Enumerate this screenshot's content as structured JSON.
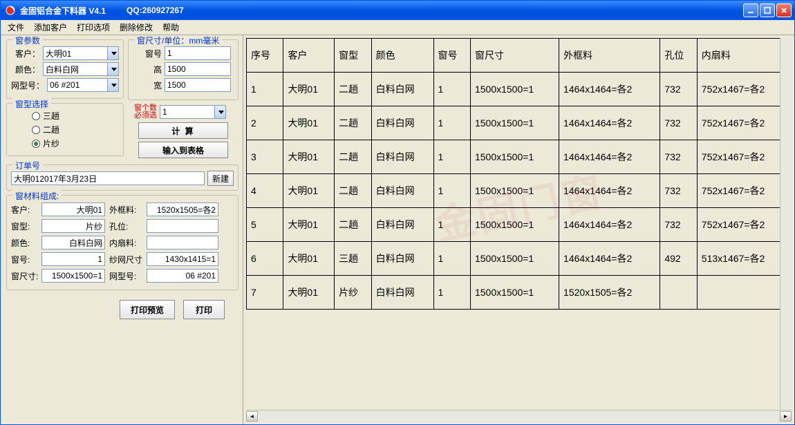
{
  "titlebar": {
    "title": "金固铝合金下料器  V4.1",
    "qq": "QQ:260927267"
  },
  "menu": {
    "file": "文件",
    "addCustomer": "添加客户",
    "printOptions": "打印选项",
    "deleteEdit": "删除修改",
    "help": "帮助"
  },
  "params": {
    "legend": "窗参数",
    "customerLabel": "客户：",
    "customer": "大明01",
    "colorLabel": "颜色：",
    "color": "白料白网",
    "meshLabel": "网型号：",
    "mesh": "06 #201"
  },
  "sizes": {
    "legend": "窗尺寸/单位：mm毫米",
    "noLabel": "窗号",
    "no": "1",
    "heightLabel": "高",
    "height": "1500",
    "widthLabel": "宽",
    "width": "1500",
    "countLabel1": "窗个数",
    "countLabel2": "必须选",
    "count": "1"
  },
  "windowType": {
    "legend": "窗型选择",
    "opt1": "三趟",
    "opt2": "二趟",
    "opt3": "片纱",
    "selected": 3
  },
  "buttons": {
    "calc": "计    算",
    "toTable": "输入到表格",
    "preview": "打印预览",
    "print": "打印",
    "new": "新建"
  },
  "order": {
    "legend": "订单号",
    "value": "大明012017年3月23日"
  },
  "material": {
    "legend": "窗材料组成:",
    "r1a": "客户:",
    "r1av": "大明01",
    "r1b": "外框料:",
    "r1bv": "1520x1505=各2",
    "r2a": "窗型:",
    "r2av": "片纱",
    "r2b": "孔位:",
    "r2bv": "",
    "r3a": "颜色:",
    "r3av": "白料白网",
    "r3b": "内扇料:",
    "r3bv": "",
    "r4a": "窗号:",
    "r4av": "1",
    "r4b": "纱网尺寸",
    "r4bv": "1430x1415=1",
    "r5a": "窗尺寸:",
    "r5av": "1500x1500=1",
    "r5b": "网型号:",
    "r5bv": "06 #201"
  },
  "table": {
    "headers": [
      "序号",
      "客户",
      "窗型",
      "颜色",
      "窗号",
      "窗尺寸",
      "外框料",
      "孔位",
      "内扇料"
    ],
    "rows": [
      [
        "1",
        "大明01",
        "二趟",
        "白料白网",
        "1",
        "1500x1500=1",
        "1464x1464=各2",
        "732",
        "752x1467=各2"
      ],
      [
        "2",
        "大明01",
        "二趟",
        "白料白网",
        "1",
        "1500x1500=1",
        "1464x1464=各2",
        "732",
        "752x1467=各2"
      ],
      [
        "3",
        "大明01",
        "二趟",
        "白料白网",
        "1",
        "1500x1500=1",
        "1464x1464=各2",
        "732",
        "752x1467=各2"
      ],
      [
        "4",
        "大明01",
        "二趟",
        "白料白网",
        "1",
        "1500x1500=1",
        "1464x1464=各2",
        "732",
        "752x1467=各2"
      ],
      [
        "5",
        "大明01",
        "二趟",
        "白料白网",
        "1",
        "1500x1500=1",
        "1464x1464=各2",
        "732",
        "752x1467=各2"
      ],
      [
        "6",
        "大明01",
        "三趟",
        "白料白网",
        "1",
        "1500x1500=1",
        "1464x1464=各2",
        "492",
        "513x1467=各2"
      ],
      [
        "7",
        "大明01",
        "片纱",
        "白料白网",
        "1",
        "1500x1500=1",
        "1520x1505=各2",
        "",
        ""
      ]
    ]
  },
  "watermark": "金固门窗"
}
